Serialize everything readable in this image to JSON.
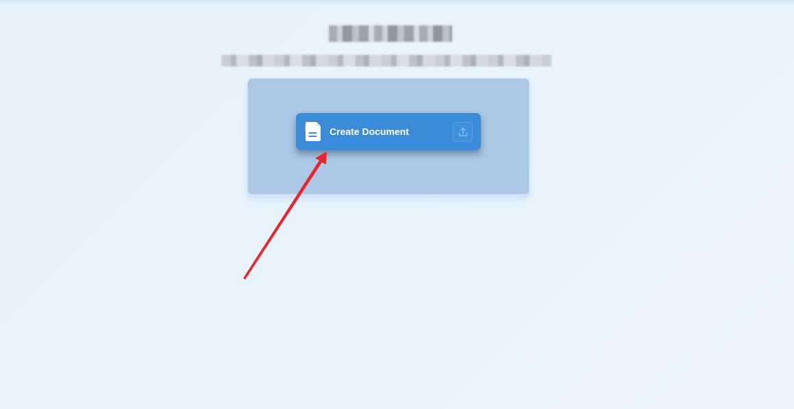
{
  "header": {
    "title": "",
    "subtitle": ""
  },
  "create_card": {
    "label": "Create Document",
    "icon": "document-icon",
    "upload_icon": "upload-icon"
  },
  "annotation": {
    "type": "arrow",
    "color": "#e8262b"
  },
  "colors": {
    "background": "#e8f3fc",
    "panel": "#abc8e6",
    "card": "#3a8bd8",
    "card_text": "#ffffff",
    "arrow": "#e8262b"
  }
}
